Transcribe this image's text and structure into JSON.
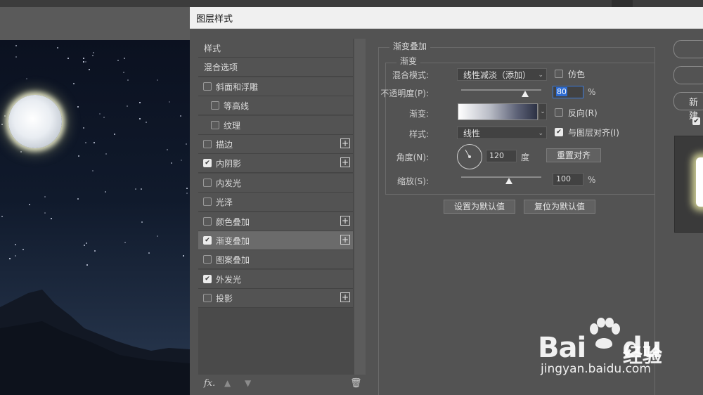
{
  "dialog": {
    "title": "图层样式"
  },
  "style_list": {
    "items": [
      {
        "label": "样式",
        "checkbox": false,
        "checked": false,
        "plus": false,
        "indent": 0,
        "selected": false
      },
      {
        "label": "混合选项",
        "checkbox": false,
        "checked": false,
        "plus": false,
        "indent": 0,
        "selected": false
      },
      {
        "label": "斜面和浮雕",
        "checkbox": true,
        "checked": false,
        "plus": false,
        "indent": 0,
        "selected": false
      },
      {
        "label": "等高线",
        "checkbox": true,
        "checked": false,
        "plus": false,
        "indent": 1,
        "selected": false
      },
      {
        "label": "纹理",
        "checkbox": true,
        "checked": false,
        "plus": false,
        "indent": 1,
        "selected": false
      },
      {
        "label": "描边",
        "checkbox": true,
        "checked": false,
        "plus": true,
        "indent": 0,
        "selected": false
      },
      {
        "label": "内阴影",
        "checkbox": true,
        "checked": true,
        "plus": true,
        "indent": 0,
        "selected": false
      },
      {
        "label": "内发光",
        "checkbox": true,
        "checked": false,
        "plus": false,
        "indent": 0,
        "selected": false
      },
      {
        "label": "光泽",
        "checkbox": true,
        "checked": false,
        "plus": false,
        "indent": 0,
        "selected": false
      },
      {
        "label": "颜色叠加",
        "checkbox": true,
        "checked": false,
        "plus": true,
        "indent": 0,
        "selected": false
      },
      {
        "label": "渐变叠加",
        "checkbox": true,
        "checked": true,
        "plus": true,
        "indent": 0,
        "selected": true
      },
      {
        "label": "图案叠加",
        "checkbox": true,
        "checked": false,
        "plus": false,
        "indent": 0,
        "selected": false
      },
      {
        "label": "外发光",
        "checkbox": true,
        "checked": true,
        "plus": false,
        "indent": 0,
        "selected": false
      },
      {
        "label": "投影",
        "checkbox": true,
        "checked": false,
        "plus": true,
        "indent": 0,
        "selected": false
      }
    ],
    "footer": {
      "fx": "fx",
      "fx_suffix": "."
    }
  },
  "settings": {
    "section_title": "渐变叠加",
    "group_title": "渐变",
    "blend_mode": {
      "label": "混合模式:",
      "value": "线性减淡（添加）"
    },
    "dither": {
      "label": "仿色",
      "checked": false
    },
    "opacity": {
      "label": "不透明度(P):",
      "value": "80",
      "unit": "%",
      "slider_fraction": 0.8
    },
    "gradient": {
      "label": "渐变:"
    },
    "reverse": {
      "label": "反向(R)",
      "checked": false
    },
    "style": {
      "label": "样式:",
      "value": "线性"
    },
    "align_with_layer": {
      "label": "与图层对齐(I)",
      "checked": true
    },
    "angle": {
      "label": "角度(N):",
      "value": "120",
      "unit": "度",
      "reset_label": "重置对齐"
    },
    "scale": {
      "label": "缩放(S):",
      "value": "100",
      "unit": "%",
      "slider_fraction": 0.6
    },
    "make_default_label": "设置为默认值",
    "reset_default_label": "复位为默认值"
  },
  "right_strip": {
    "new_button_label": "新建"
  },
  "watermark": {
    "brand": "Bai",
    "brand_tail": "du",
    "sub": "经验",
    "url": "jingyan.baidu.com"
  },
  "colors": {
    "panel": "#535353",
    "selected_row": "#6b6b6b",
    "focus": "#3c7bd9"
  }
}
